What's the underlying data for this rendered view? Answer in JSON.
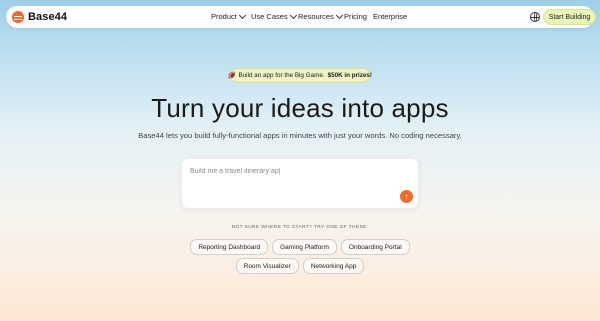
{
  "nav": {
    "logo_text": "Base44",
    "menu": [
      {
        "label": "Product",
        "has_dropdown": true
      },
      {
        "label": "Use Cases",
        "has_dropdown": true
      },
      {
        "label": "Resources",
        "has_dropdown": true
      },
      {
        "label": "Pricing",
        "has_dropdown": false
      },
      {
        "label": "Enterprise",
        "has_dropdown": false
      }
    ],
    "globe_icon": "globe-icon",
    "cta_label": "Start Building"
  },
  "promo": {
    "emoji": "🏈",
    "text": "Build an app for the Big Game.",
    "highlight": "$50K in prizes!"
  },
  "hero": {
    "title": "Turn your ideas into apps",
    "subtitle": "Base44 lets you build fully-functional apps in minutes with just your words. No coding necessary."
  },
  "prompt": {
    "placeholder": "Build me a travel itinerary ap|",
    "send_icon": "arrow-up-icon"
  },
  "suggestions": {
    "label": "NOT SURE WHERE TO START? TRY ONE OF THESE:",
    "row1": [
      "Reporting Dashboard",
      "Gaming Platform",
      "Onboarding Portal"
    ],
    "row2": [
      "Room Visualizer",
      "Networking App"
    ]
  },
  "colors": {
    "accent": "#f06a2a",
    "cta_bg": "#e9f4b6"
  }
}
